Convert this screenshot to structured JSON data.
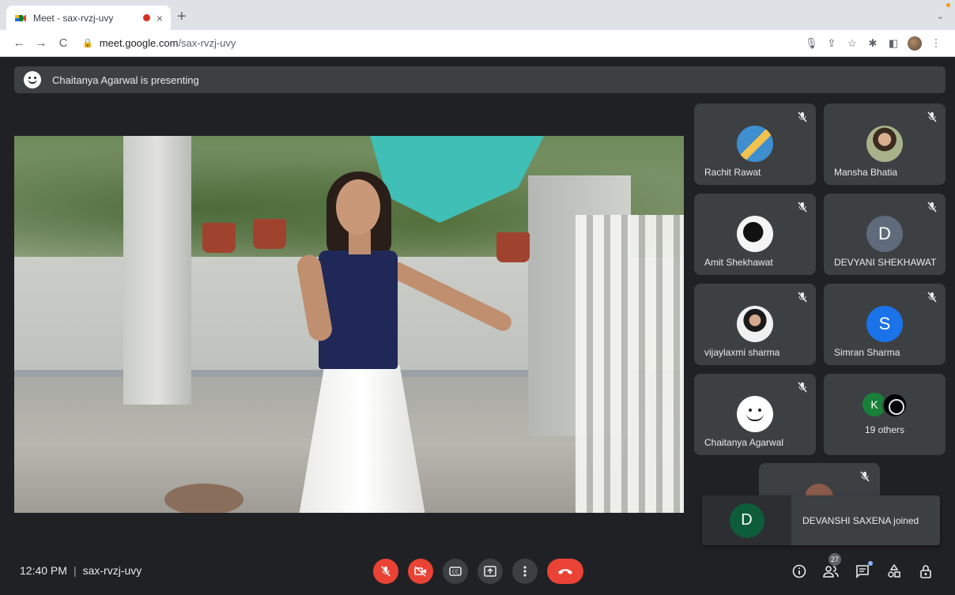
{
  "browser": {
    "tab_title": "Meet - sax-rvzj-uvy",
    "tab_close": "×",
    "new_tab": "+",
    "tab_menu": "⌄",
    "url_host": "meet.google.com",
    "url_path": "/sax-rvzj-uvy"
  },
  "meet": {
    "presenting_text": "Chaitanya Agarwal is presenting",
    "participants": [
      {
        "name": "Rachit Rawat",
        "avatar_letter": "",
        "muted": true
      },
      {
        "name": "Mansha Bhatia",
        "avatar_letter": "",
        "muted": true
      },
      {
        "name": "Amit Shekhawat",
        "avatar_letter": "",
        "muted": true
      },
      {
        "name": "DEVYANI SHEKHAWAT",
        "avatar_letter": "D",
        "muted": true
      },
      {
        "name": "vijaylaxmi sharma",
        "avatar_letter": "",
        "muted": true
      },
      {
        "name": "Simran Sharma",
        "avatar_letter": "S",
        "muted": true
      },
      {
        "name": "Chaitanya Agarwal",
        "avatar_letter": "",
        "muted": true
      }
    ],
    "others": {
      "label": "19 others",
      "avatar_letter": "K"
    },
    "toast": {
      "avatar_letter": "D",
      "message": "DEVANSHI SAXENA joined"
    },
    "bottom": {
      "time": "12:40 PM",
      "separator": "|",
      "meeting_code": "sax-rvzj-uvy",
      "people_count": "27"
    },
    "colors": {
      "background": "#202124",
      "tile": "#3c4043",
      "danger": "#ea4335",
      "avatar_devyani": "#5f6b7a",
      "avatar_simran": "#1a73e8"
    }
  }
}
